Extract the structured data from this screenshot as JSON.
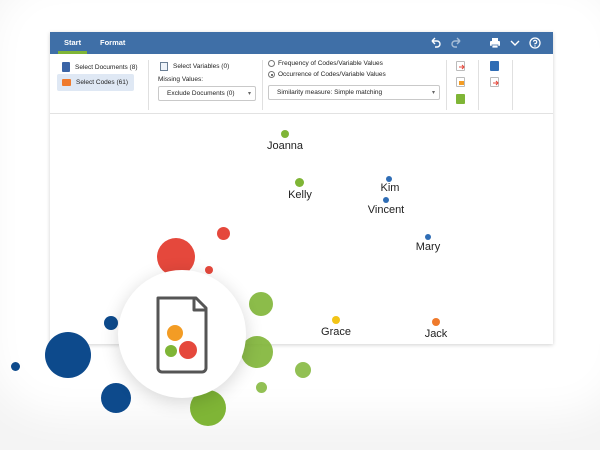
{
  "tabs": {
    "start": "Start",
    "format": "Format"
  },
  "ribbon": {
    "select_documents": "Select Documents (8)",
    "select_codes": "Select Codes (61)",
    "select_variables": "Select Variables (0)",
    "missing_values_label": "Missing Values:",
    "missing_values_value": "Exclude Documents (0)",
    "radio_frequency": "Frequency of Codes/Variable Values",
    "radio_occurrence": "Occurrence of Codes/Variable Values",
    "similarity_value": "Similarity measure: Simple matching"
  },
  "map": {
    "points": [
      {
        "label": "Joanna",
        "color": "#7fb536"
      },
      {
        "label": "Kelly",
        "color": "#7fb536"
      },
      {
        "label": "Kim",
        "color": "#2f6db5"
      },
      {
        "label": "Vincent",
        "color": "#2f6db5"
      },
      {
        "label": "Mary",
        "color": "#2f6db5"
      },
      {
        "label": "Grace",
        "color": "#f2c417"
      },
      {
        "label": "Jack",
        "color": "#ef7a2c"
      }
    ]
  },
  "colors": {
    "accent_blue": "#3f6fa7",
    "green": "#7fb536",
    "red": "#e5483c",
    "navy": "#0d4a8c",
    "orange": "#f39c24"
  }
}
